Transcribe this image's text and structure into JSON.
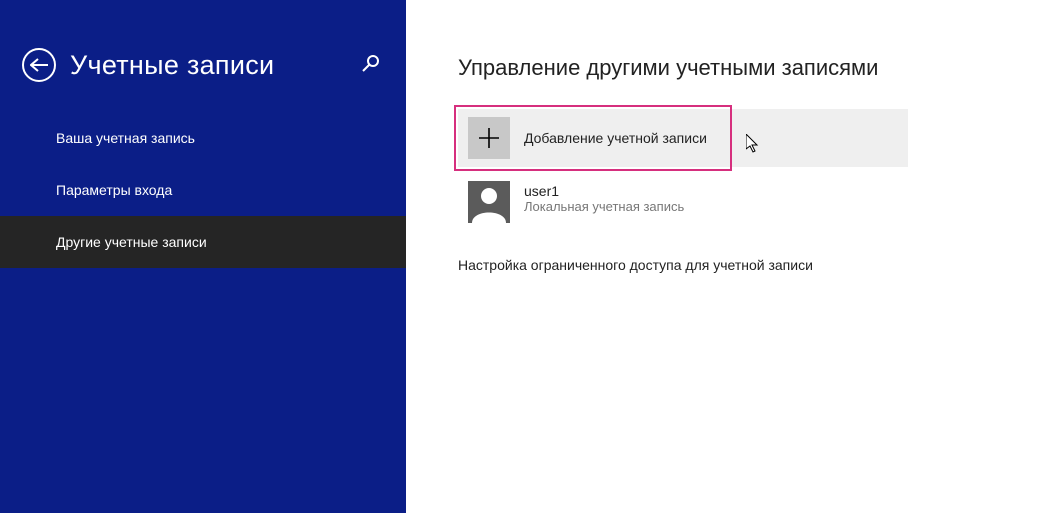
{
  "sidebar": {
    "title": "Учетные записи",
    "items": [
      {
        "label": "Ваша учетная запись"
      },
      {
        "label": "Параметры входа"
      },
      {
        "label": "Другие учетные записи"
      }
    ],
    "active_index": 2
  },
  "main": {
    "title": "Управление другими учетными записями",
    "add_account_label": "Добавление учетной записи",
    "user": {
      "name": "user1",
      "type": "Локальная учетная запись"
    },
    "restricted_link": "Настройка ограниченного доступа для учетной записи"
  },
  "colors": {
    "sidebar_bg": "#0b1e87",
    "active_bg": "#252525",
    "highlight": "#d62f7e"
  }
}
